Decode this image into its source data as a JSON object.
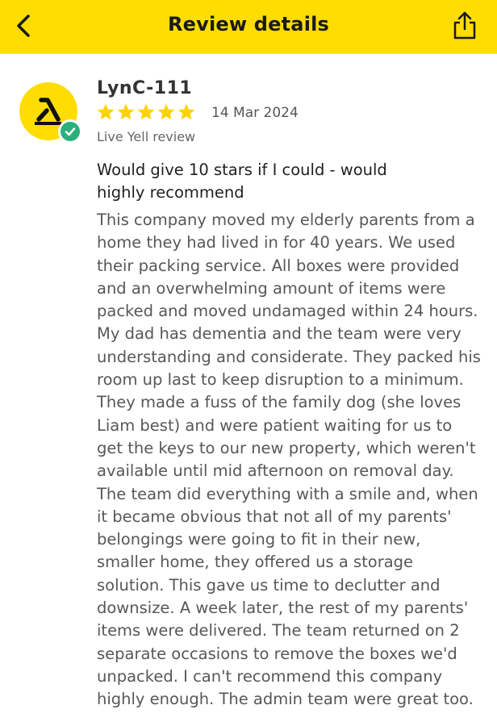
{
  "header": {
    "title": "Review details",
    "background": "#FFDD00",
    "back_icon": "chevron-left-icon",
    "share_icon": "share-icon"
  },
  "review": {
    "author": "LynC-111",
    "rating": 5,
    "rating_max": 5,
    "star_color": "#FFD200",
    "date": "14 Mar 2024",
    "source": "Live Yell review",
    "verified": true,
    "verified_color": "#2ab07c",
    "title": "Would give 10 stars if I could - would highly recommend",
    "body": "This company moved my elderly parents from a home they had lived in for 40 years. We used their packing service. All boxes were provided and an overwhelming amount of items were packed and moved undamaged within 24 hours. My dad has dementia and the team were very understanding and considerate. They packed his room up last to keep disruption to a minimum. They made a fuss of the family dog (she loves Liam best) and were patient waiting for us to get the keys to our new property, which weren't available until mid afternoon on removal day. The team did everything with a smile and, when it became obvious that not all of my parents' belongings were going to fit in their new, smaller home, they offered us a storage solution. This gave us time to declutter and downsize.  A week later, the rest of my parents' items were delivered. The team returned on 2 separate occasions to remove the boxes we'd unpacked. I can't recommend this company highly enough. The admin team were great too."
  }
}
